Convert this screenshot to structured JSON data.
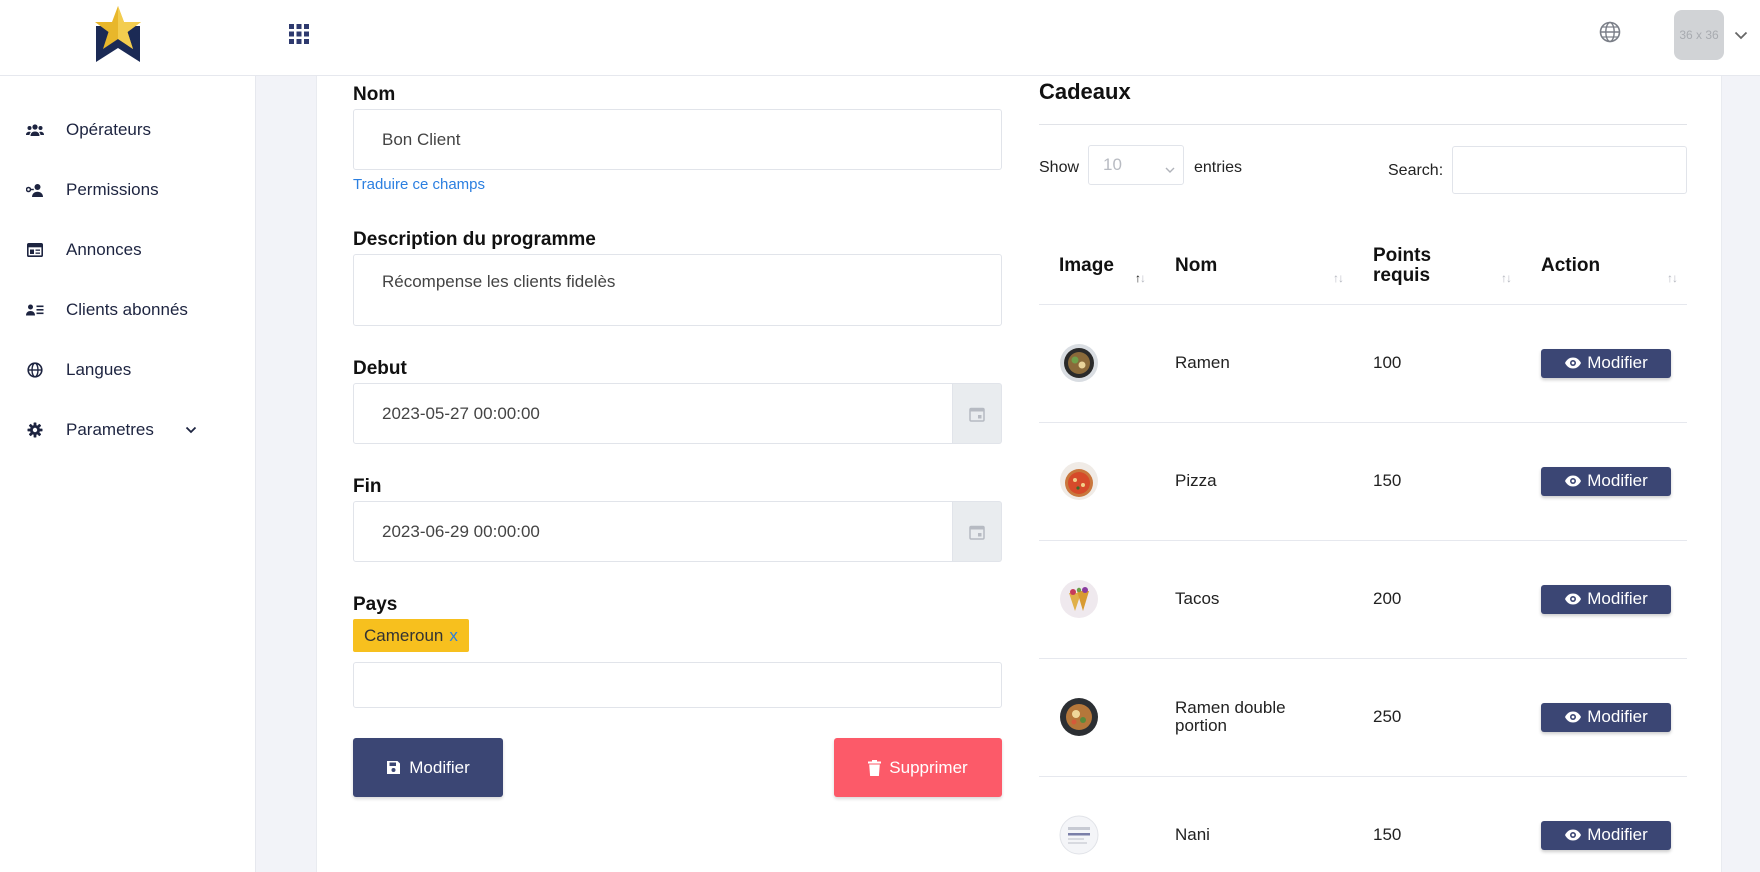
{
  "sidebar": {
    "items": [
      {
        "label": "Opérateurs",
        "icon": "users-icon"
      },
      {
        "label": "Permissions",
        "icon": "user-key-icon"
      },
      {
        "label": "Annonces",
        "icon": "newspaper-icon"
      },
      {
        "label": "Clients abonnés",
        "icon": "user-list-icon"
      },
      {
        "label": "Langues",
        "icon": "globe-icon"
      },
      {
        "label": "Parametres",
        "icon": "gear-icon"
      }
    ]
  },
  "topbar": {
    "avatar_text": "36 x 36"
  },
  "form": {
    "nom_label": "Nom",
    "nom_value": "Bon Client",
    "translate_link": "Traduire ce champs",
    "description_label": "Description du programme",
    "description_value": "Récompense les clients fidelès",
    "debut_label": "Debut",
    "debut_value": "2023-05-27 00:00:00",
    "fin_label": "Fin",
    "fin_value": "2023-06-29 00:00:00",
    "pays_label": "Pays",
    "pays_tag": "Cameroun",
    "pays_tag_remove": "x",
    "save_button": "Modifier",
    "delete_button": "Supprimer"
  },
  "cadeaux": {
    "title": "Cadeaux",
    "show_label": "Show",
    "entries_value": "10",
    "entries_label": "entries",
    "search_label": "Search:",
    "columns": [
      "Image",
      "Nom",
      "Points requis",
      "Action"
    ],
    "action_label": "Modifier",
    "rows": [
      {
        "nom": "Ramen",
        "points": "100",
        "image": "ramen-image"
      },
      {
        "nom": "Pizza",
        "points": "150",
        "image": "pizza-image"
      },
      {
        "nom": "Tacos",
        "points": "200",
        "image": "tacos-image"
      },
      {
        "nom": "Ramen double portion",
        "points": "250",
        "image": "ramen-double-image"
      },
      {
        "nom": "Nani",
        "points": "150",
        "image": "nani-image"
      }
    ]
  },
  "colors": {
    "primary": "#3b4674",
    "danger": "#fc5a69",
    "tag": "#f7c01e",
    "link": "#2b7fe0"
  }
}
